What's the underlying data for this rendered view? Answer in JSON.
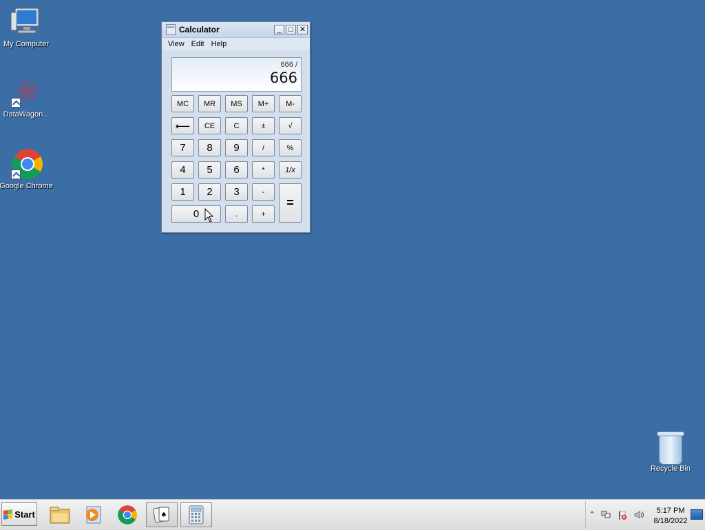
{
  "desktop": {
    "icons": [
      {
        "label": "My Computer"
      },
      {
        "label": "DataWagon..."
      },
      {
        "label": "Google Chrome"
      },
      {
        "label": "Recycle Bin"
      }
    ]
  },
  "calculator": {
    "title": "Calculator",
    "menu": [
      "View",
      "Edit",
      "Help"
    ],
    "display": {
      "expression": "666 /",
      "value": "666"
    },
    "buttons": {
      "mc": "MC",
      "mr": "MR",
      "ms": "MS",
      "mplus": "M+",
      "mminus": "M-",
      "backspace": "⟵",
      "ce": "CE",
      "c": "C",
      "plusminus": "±",
      "sqrt": "√",
      "n7": "7",
      "n8": "8",
      "n9": "9",
      "divide": "/",
      "percent": "%",
      "n4": "4",
      "n5": "5",
      "n6": "6",
      "multiply": "*",
      "reciprocal": "1/x",
      "n1": "1",
      "n2": "2",
      "n3": "3",
      "minus": "-",
      "equals": "=",
      "n0": "0",
      "decimal": ".",
      "plus": "+"
    }
  },
  "taskbar": {
    "start_label": "Start",
    "clock": {
      "time": "5:17 PM",
      "date": "8/18/2022"
    },
    "active_app": "calculator"
  }
}
